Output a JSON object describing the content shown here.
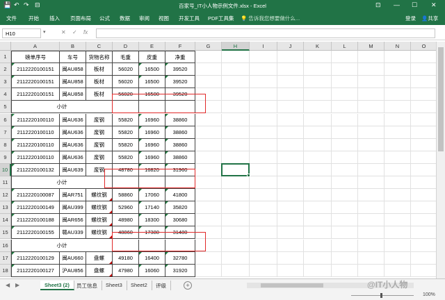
{
  "titlebar": {
    "title": "百家号_IT小人物示例文件.xlsx - Excel",
    "quick_access": [
      "💾",
      "↶",
      "↷",
      "⊟"
    ],
    "window_buttons": [
      "⊡",
      "—",
      "☐",
      "✕"
    ]
  },
  "ribbon": {
    "tabs": [
      "文件",
      "开始",
      "插入",
      "页面布局",
      "公式",
      "数据",
      "审阅",
      "视图",
      "开发工具",
      "PDF工具集"
    ],
    "tell_me": "💡 告诉我您想要做什么...",
    "login": "登录",
    "share": "共享"
  },
  "formula_bar": {
    "name_box": "H10",
    "cancel": "✕",
    "confirm": "✓",
    "fx": "fx",
    "formula": ""
  },
  "columns": [
    "A",
    "B",
    "C",
    "D",
    "E",
    "F",
    "G",
    "H",
    "I",
    "J",
    "K",
    "L",
    "M",
    "N",
    "O"
  ],
  "selected_cell": {
    "col": "H",
    "row": 10
  },
  "table": {
    "headers": [
      "磅单序号",
      "车号",
      "货物名称",
      "毛重",
      "皮重",
      "净重"
    ],
    "rows": [
      {
        "row": 2,
        "cells": [
          "2112220100151",
          "闽AU858",
          "板材",
          "56020",
          "16500",
          "39520"
        ]
      },
      {
        "row": 3,
        "cells": [
          "2112220100151",
          "闽AU858",
          "板材",
          "56020",
          "16500",
          "39520"
        ]
      },
      {
        "row": 4,
        "cells": [
          "2112220100151",
          "闽AU858",
          "板材",
          "56020",
          "16500",
          "39520"
        ]
      },
      {
        "row": 5,
        "subtotal": "小计"
      },
      {
        "row": 6,
        "cells": [
          "2112220100110",
          "闽AU636",
          "废钢",
          "55820",
          "16960",
          "38860"
        ]
      },
      {
        "row": 7,
        "cells": [
          "2112220100110",
          "闽AU636",
          "废钢",
          "55820",
          "16960",
          "38860"
        ]
      },
      {
        "row": 8,
        "cells": [
          "2112220100110",
          "闽AU636",
          "废钢",
          "55820",
          "16960",
          "38860"
        ]
      },
      {
        "row": 9,
        "cells": [
          "2112220100110",
          "闽AU636",
          "废钢",
          "55820",
          "16960",
          "38860"
        ]
      },
      {
        "row": 10,
        "cells": [
          "2112220100132",
          "闽AU639",
          "废钢",
          "48780",
          "16820",
          "31960"
        ]
      },
      {
        "row": 11,
        "subtotal": "小计"
      },
      {
        "row": 12,
        "cells": [
          "2112220100087",
          "闽AR751",
          "螺纹钢",
          "58860",
          "17060",
          "41800"
        ]
      },
      {
        "row": 13,
        "cells": [
          "2112220100149",
          "闽AU399",
          "螺纹钢",
          "52960",
          "17140",
          "35820"
        ]
      },
      {
        "row": 14,
        "cells": [
          "2112220100188",
          "闽AR656",
          "螺纹钢",
          "48980",
          "18300",
          "30680"
        ]
      },
      {
        "row": 15,
        "cells": [
          "2112220100155",
          "赣AU339",
          "螺纹钢",
          "48860",
          "17380",
          "31480"
        ]
      },
      {
        "row": 16,
        "subtotal": "小计"
      },
      {
        "row": 17,
        "cells": [
          "2112220100129",
          "闽AU660",
          "盘螺",
          "49180",
          "16400",
          "32780"
        ]
      },
      {
        "row": 18,
        "cells": [
          "2112220100127",
          "沪AU856",
          "盘螺",
          "47980",
          "16060",
          "31920"
        ]
      }
    ]
  },
  "sheets": [
    {
      "name": "Sheet3 (2)",
      "active": true
    },
    {
      "name": "员工信息",
      "active": false
    },
    {
      "name": "Sheet3",
      "active": false
    },
    {
      "name": "Sheet2",
      "active": false
    },
    {
      "name": "评级",
      "active": false
    }
  ],
  "sheet_nav": [
    "◀",
    "▶"
  ],
  "add_sheet": "+",
  "watermark": "@IT小人物",
  "status": {
    "zoom": "100%"
  },
  "colors": {
    "accent": "#217346",
    "highlight_box": "#e02828"
  }
}
